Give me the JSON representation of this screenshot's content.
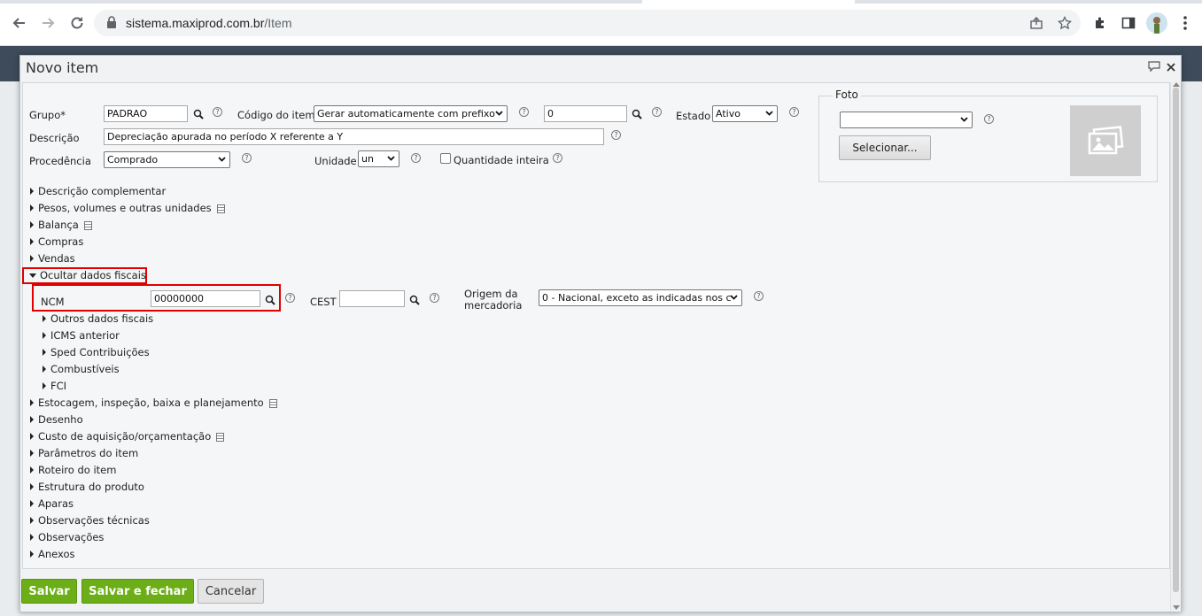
{
  "browser": {
    "url_host": "sistema.maxiprod.com.br",
    "url_path": "/Item"
  },
  "dialog": {
    "title": "Novo item"
  },
  "form": {
    "grupo_label": "Grupo*",
    "grupo_value": "PADRAO",
    "codigo_label": "Código do item",
    "codigo_select": "Gerar automaticamente com prefixo",
    "codigo_value": "0",
    "estado_label": "Estado",
    "estado_value": "Ativo",
    "descricao_label": "Descrição",
    "descricao_value": "Depreciação apurada no período X referente a Y",
    "procedencia_label": "Procedência",
    "procedencia_value": "Comprado",
    "unidade_label": "Unidade",
    "unidade_value": "un",
    "quantidade_inteira_label": "Quantidade inteira",
    "help_glyph": "?"
  },
  "foto": {
    "legend": "Foto",
    "select_value": "",
    "select_button": "Selecionar..."
  },
  "sections": {
    "descricao_complementar": "Descrição complementar",
    "pesos": "Pesos, volumes e outras unidades",
    "balanca": "Balança",
    "compras": "Compras",
    "vendas": "Vendas",
    "ocultar_fiscais": "Ocultar dados fiscais",
    "outros_fiscais": "Outros dados fiscais",
    "icms_anterior": "ICMS anterior",
    "sped": "Sped Contribuições",
    "combustiveis": "Combustíveis",
    "fci": "FCI",
    "estocagem": "Estocagem, inspeção, baixa e planejamento",
    "desenho": "Desenho",
    "custo": "Custo de aquisição/orçamentação",
    "parametros": "Parâmetros do item",
    "roteiro": "Roteiro do item",
    "estrutura": "Estrutura do produto",
    "aparas": "Aparas",
    "obs_tecnicas": "Observações técnicas",
    "observacoes": "Observações",
    "anexos": "Anexos"
  },
  "fiscal": {
    "ncm_label": "NCM",
    "ncm_value": "00000000",
    "cest_label": "CEST",
    "cest_value": "",
    "origem_label_1": "Origem da",
    "origem_label_2": "mercadoria",
    "origem_value": "0 - Nacional, exceto as indicadas nos c"
  },
  "buttons": {
    "salvar": "Salvar",
    "salvar_fechar": "Salvar e fechar",
    "cancelar": "Cancelar"
  },
  "colors": {
    "accent_green": "#6cae17",
    "highlight_red": "#e00000"
  }
}
